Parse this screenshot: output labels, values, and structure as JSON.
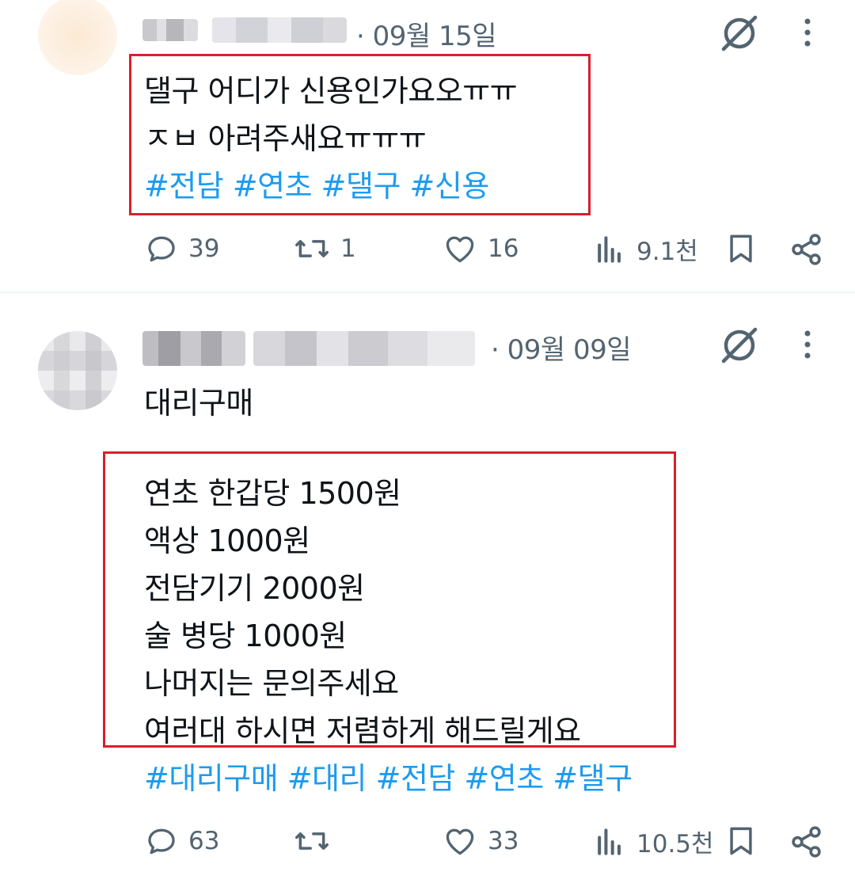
{
  "posts": [
    {
      "date": "· 09월 15일",
      "lines": [
        "댈구 어디가 신용인가요오ㅠㅠ",
        "ㅈㅂ 아려주새요ㅠㅠㅠ"
      ],
      "hashtags": "#전담 #연초 #댈구 #신용",
      "replies": "39",
      "reposts": "1",
      "likes": "16",
      "views": "9.1천"
    },
    {
      "date": "· 09월 09일",
      "title": "대리구매",
      "lines": [
        "연초 한갑당 1500원",
        "액상 1000원",
        "전담기기 2000원",
        "술 병당 1000원",
        "나머지는 문의주세요",
        "여러대 하시면 저렴하게 해드릴게요"
      ],
      "hashtags": "#대리구매 #대리 #전담 #연초 #댈구",
      "replies": "63",
      "reposts": "",
      "likes": "33",
      "views": "10.5천"
    }
  ],
  "icons": {
    "grok": "grok-icon",
    "more": "more-vertical-icon",
    "reply": "reply-icon",
    "repost": "repost-icon",
    "like": "heart-icon",
    "views": "views-icon",
    "bookmark": "bookmark-icon",
    "share": "share-icon"
  },
  "colors": {
    "text": "#0f1419",
    "secondary": "#536471",
    "hashtag": "#1d9bf0",
    "highlight": "#dc1e2d"
  }
}
